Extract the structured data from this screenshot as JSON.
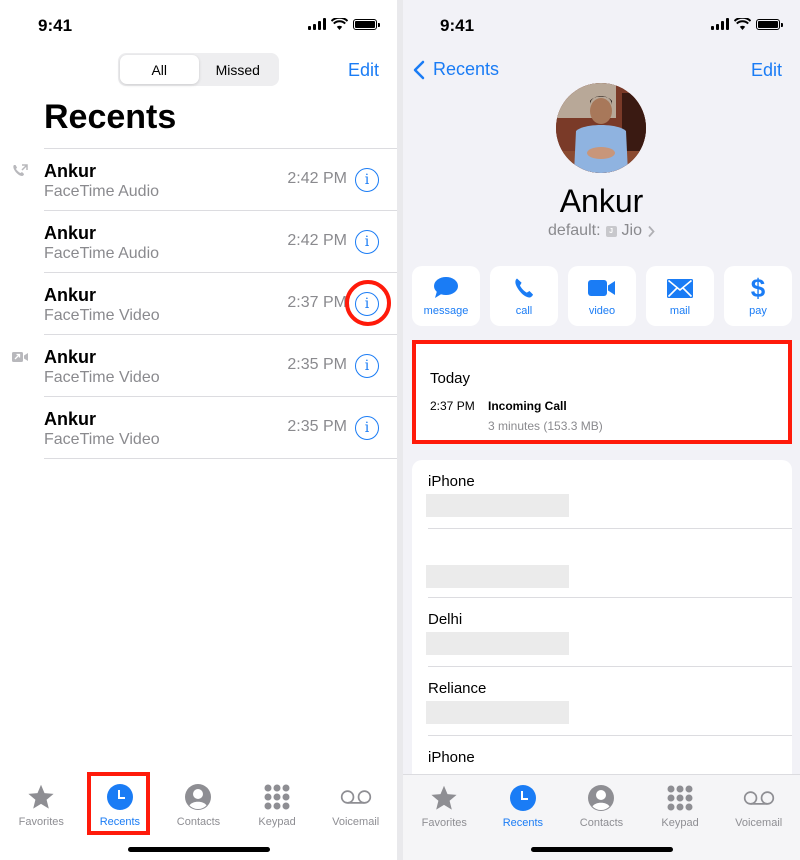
{
  "status_bar": {
    "time": "9:41"
  },
  "left": {
    "segments": [
      {
        "label": "All",
        "active": true
      },
      {
        "label": "Missed",
        "active": false
      }
    ],
    "edit_label": "Edit",
    "title": "Recents",
    "calls": [
      {
        "name": "Ankur",
        "type": "FaceTime Audio",
        "time": "2:42 PM",
        "icon": "outgoing-call-icon"
      },
      {
        "name": "Ankur",
        "type": "FaceTime Audio",
        "time": "2:42 PM",
        "icon": ""
      },
      {
        "name": "Ankur",
        "type": "FaceTime Video",
        "time": "2:37 PM",
        "icon": "",
        "highlighted": true
      },
      {
        "name": "Ankur",
        "type": "FaceTime Video",
        "time": "2:35 PM",
        "icon": "outgoing-video-icon"
      },
      {
        "name": "Ankur",
        "type": "FaceTime Video",
        "time": "2:35 PM",
        "icon": ""
      }
    ],
    "info_glyph": "i"
  },
  "tabbar": {
    "tabs": [
      {
        "label": "Favorites",
        "icon": "star-icon"
      },
      {
        "label": "Recents",
        "icon": "clock-icon",
        "active": true
      },
      {
        "label": "Contacts",
        "icon": "person-circle-icon"
      },
      {
        "label": "Keypad",
        "icon": "keypad-icon"
      },
      {
        "label": "Voicemail",
        "icon": "voicemail-icon"
      }
    ]
  },
  "right": {
    "back_label": "Recents",
    "edit_label": "Edit",
    "contact_name": "Ankur",
    "carrier_prefix": "default:",
    "sim_badge": "J",
    "carrier_name": "Jio",
    "actions": [
      {
        "label": "message",
        "icon": "message-icon"
      },
      {
        "label": "call",
        "icon": "phone-icon"
      },
      {
        "label": "video",
        "icon": "video-icon"
      },
      {
        "label": "mail",
        "icon": "mail-icon"
      },
      {
        "label": "pay",
        "icon": "dollar-icon"
      }
    ],
    "history": {
      "heading": "Today",
      "time": "2:37 PM",
      "kind": "Incoming Call",
      "detail": "3 minutes (153.3 MB)"
    },
    "fields": [
      {
        "label": "iPhone"
      },
      {
        "label": ""
      },
      {
        "label": "Delhi"
      },
      {
        "label": "Reliance"
      },
      {
        "label": "iPhone"
      }
    ]
  },
  "colors": {
    "accent": "#1a7cf5",
    "highlight": "#ff1a0a"
  }
}
